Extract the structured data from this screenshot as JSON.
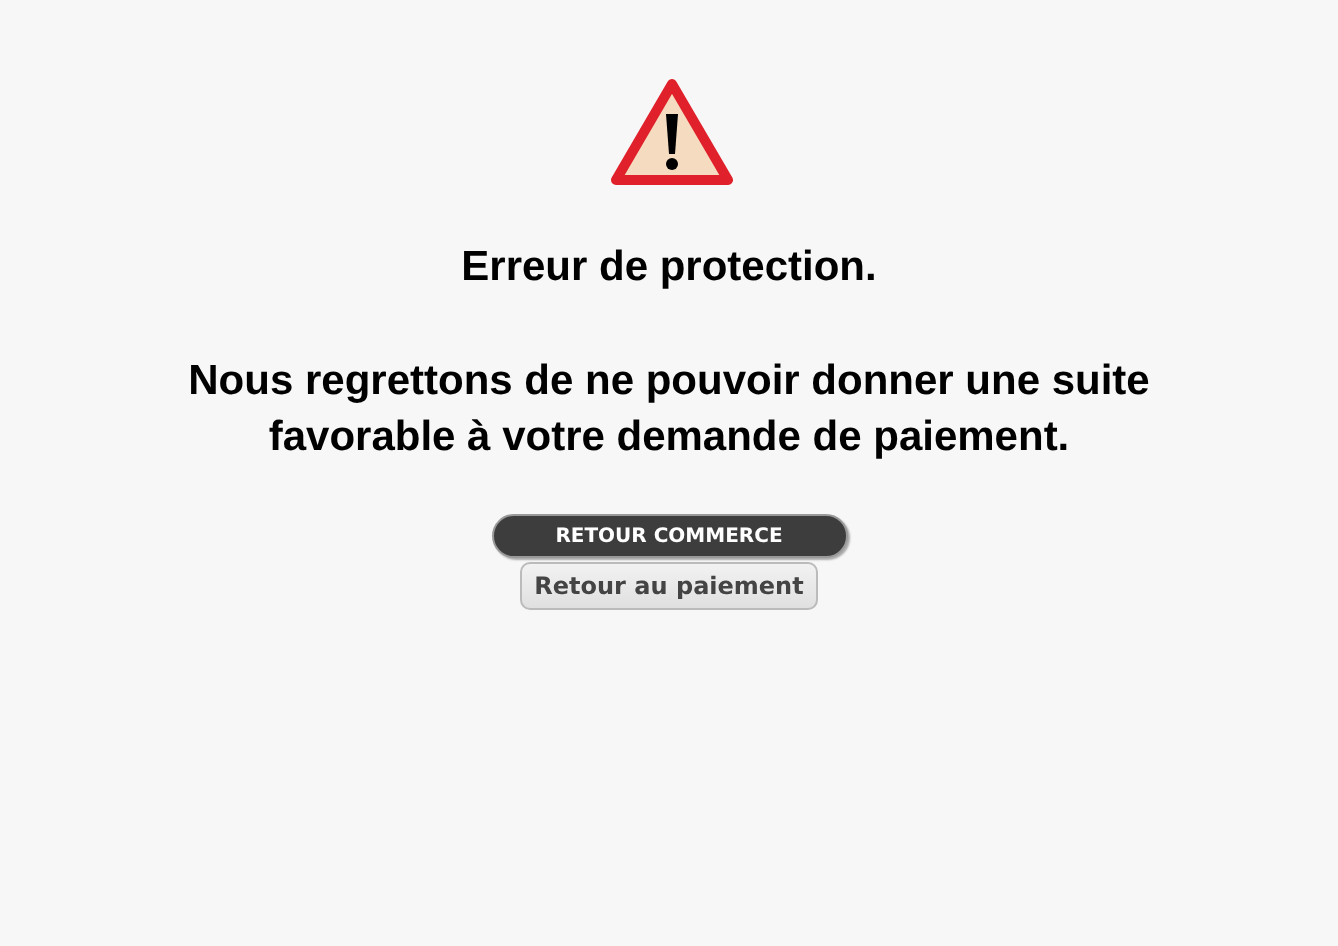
{
  "title": "Erreur de protection.",
  "message": "Nous regrettons de ne pouvoir donner une suite favorable à votre demande de paiement.",
  "buttons": [
    {
      "label": "RETOUR COMMERCE",
      "kind": "primary"
    },
    {
      "label": "Retour au paiement",
      "kind": "secondary"
    }
  ]
}
